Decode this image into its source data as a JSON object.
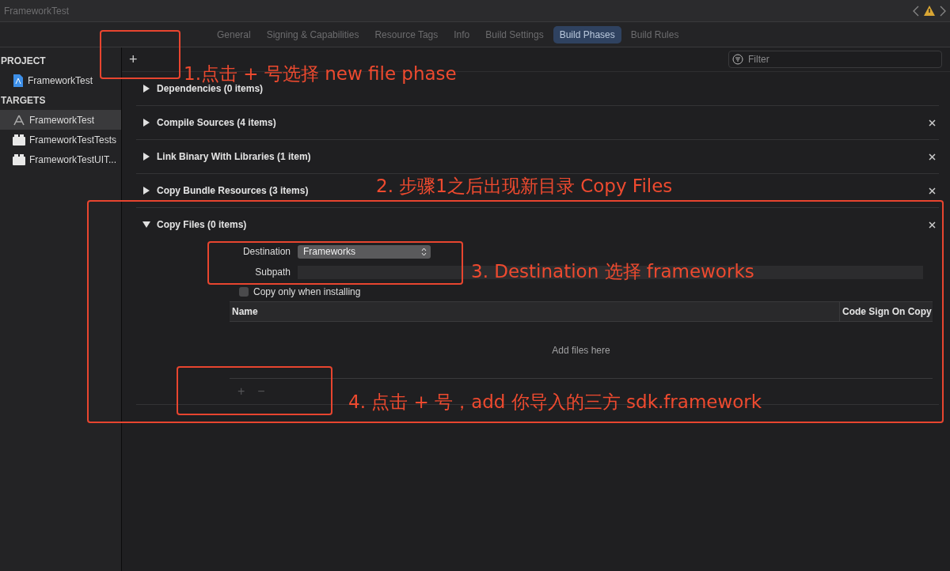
{
  "window": {
    "title": "FrameworkTest"
  },
  "tabs": [
    {
      "label": "General",
      "selected": false
    },
    {
      "label": "Signing & Capabilities",
      "selected": false
    },
    {
      "label": "Resource Tags",
      "selected": false
    },
    {
      "label": "Info",
      "selected": false
    },
    {
      "label": "Build Settings",
      "selected": false
    },
    {
      "label": "Build Phases",
      "selected": true
    },
    {
      "label": "Build Rules",
      "selected": false
    }
  ],
  "sidebar": {
    "sections": [
      {
        "title": "PROJECT",
        "items": [
          {
            "label": "FrameworkTest",
            "kind": "project",
            "selected": false
          }
        ]
      },
      {
        "title": "TARGETS",
        "items": [
          {
            "label": "FrameworkTest",
            "kind": "app",
            "selected": true
          },
          {
            "label": "FrameworkTestTests",
            "kind": "bundle",
            "selected": false
          },
          {
            "label": "FrameworkTestUIT...",
            "kind": "bundle",
            "selected": false
          }
        ]
      }
    ]
  },
  "toolbar": {
    "add": "+",
    "filter": {
      "placeholder": "Filter"
    }
  },
  "phases": [
    {
      "title": "Dependencies (0 items)",
      "expanded": false,
      "deletable": false
    },
    {
      "title": "Compile Sources (4 items)",
      "expanded": false,
      "deletable": true
    },
    {
      "title": "Link Binary With Libraries (1 item)",
      "expanded": false,
      "deletable": true
    },
    {
      "title": "Copy Bundle Resources (3 items)",
      "expanded": false,
      "deletable": true
    },
    {
      "title": "Copy Files (0 items)",
      "expanded": true,
      "deletable": true,
      "destination": {
        "label": "Destination",
        "value": "Frameworks"
      },
      "subpath": {
        "label": "Subpath"
      },
      "copy_only": {
        "label": "Copy only when installing",
        "checked": false
      },
      "table": {
        "columns": [
          "Name",
          "Code Sign On Copy"
        ],
        "empty": "Add files here"
      },
      "buttons": [
        "+",
        "−"
      ]
    }
  ],
  "annotations": [
    {
      "text": "1.点击 + 号选择 new file phase"
    },
    {
      "text": "2. 步骤1之后出现新目录 Copy Files"
    },
    {
      "text": "3. Destination 选择 frameworks"
    },
    {
      "text": "4. 点击 + 号，add 你导入的三方 sdk.framework"
    }
  ]
}
